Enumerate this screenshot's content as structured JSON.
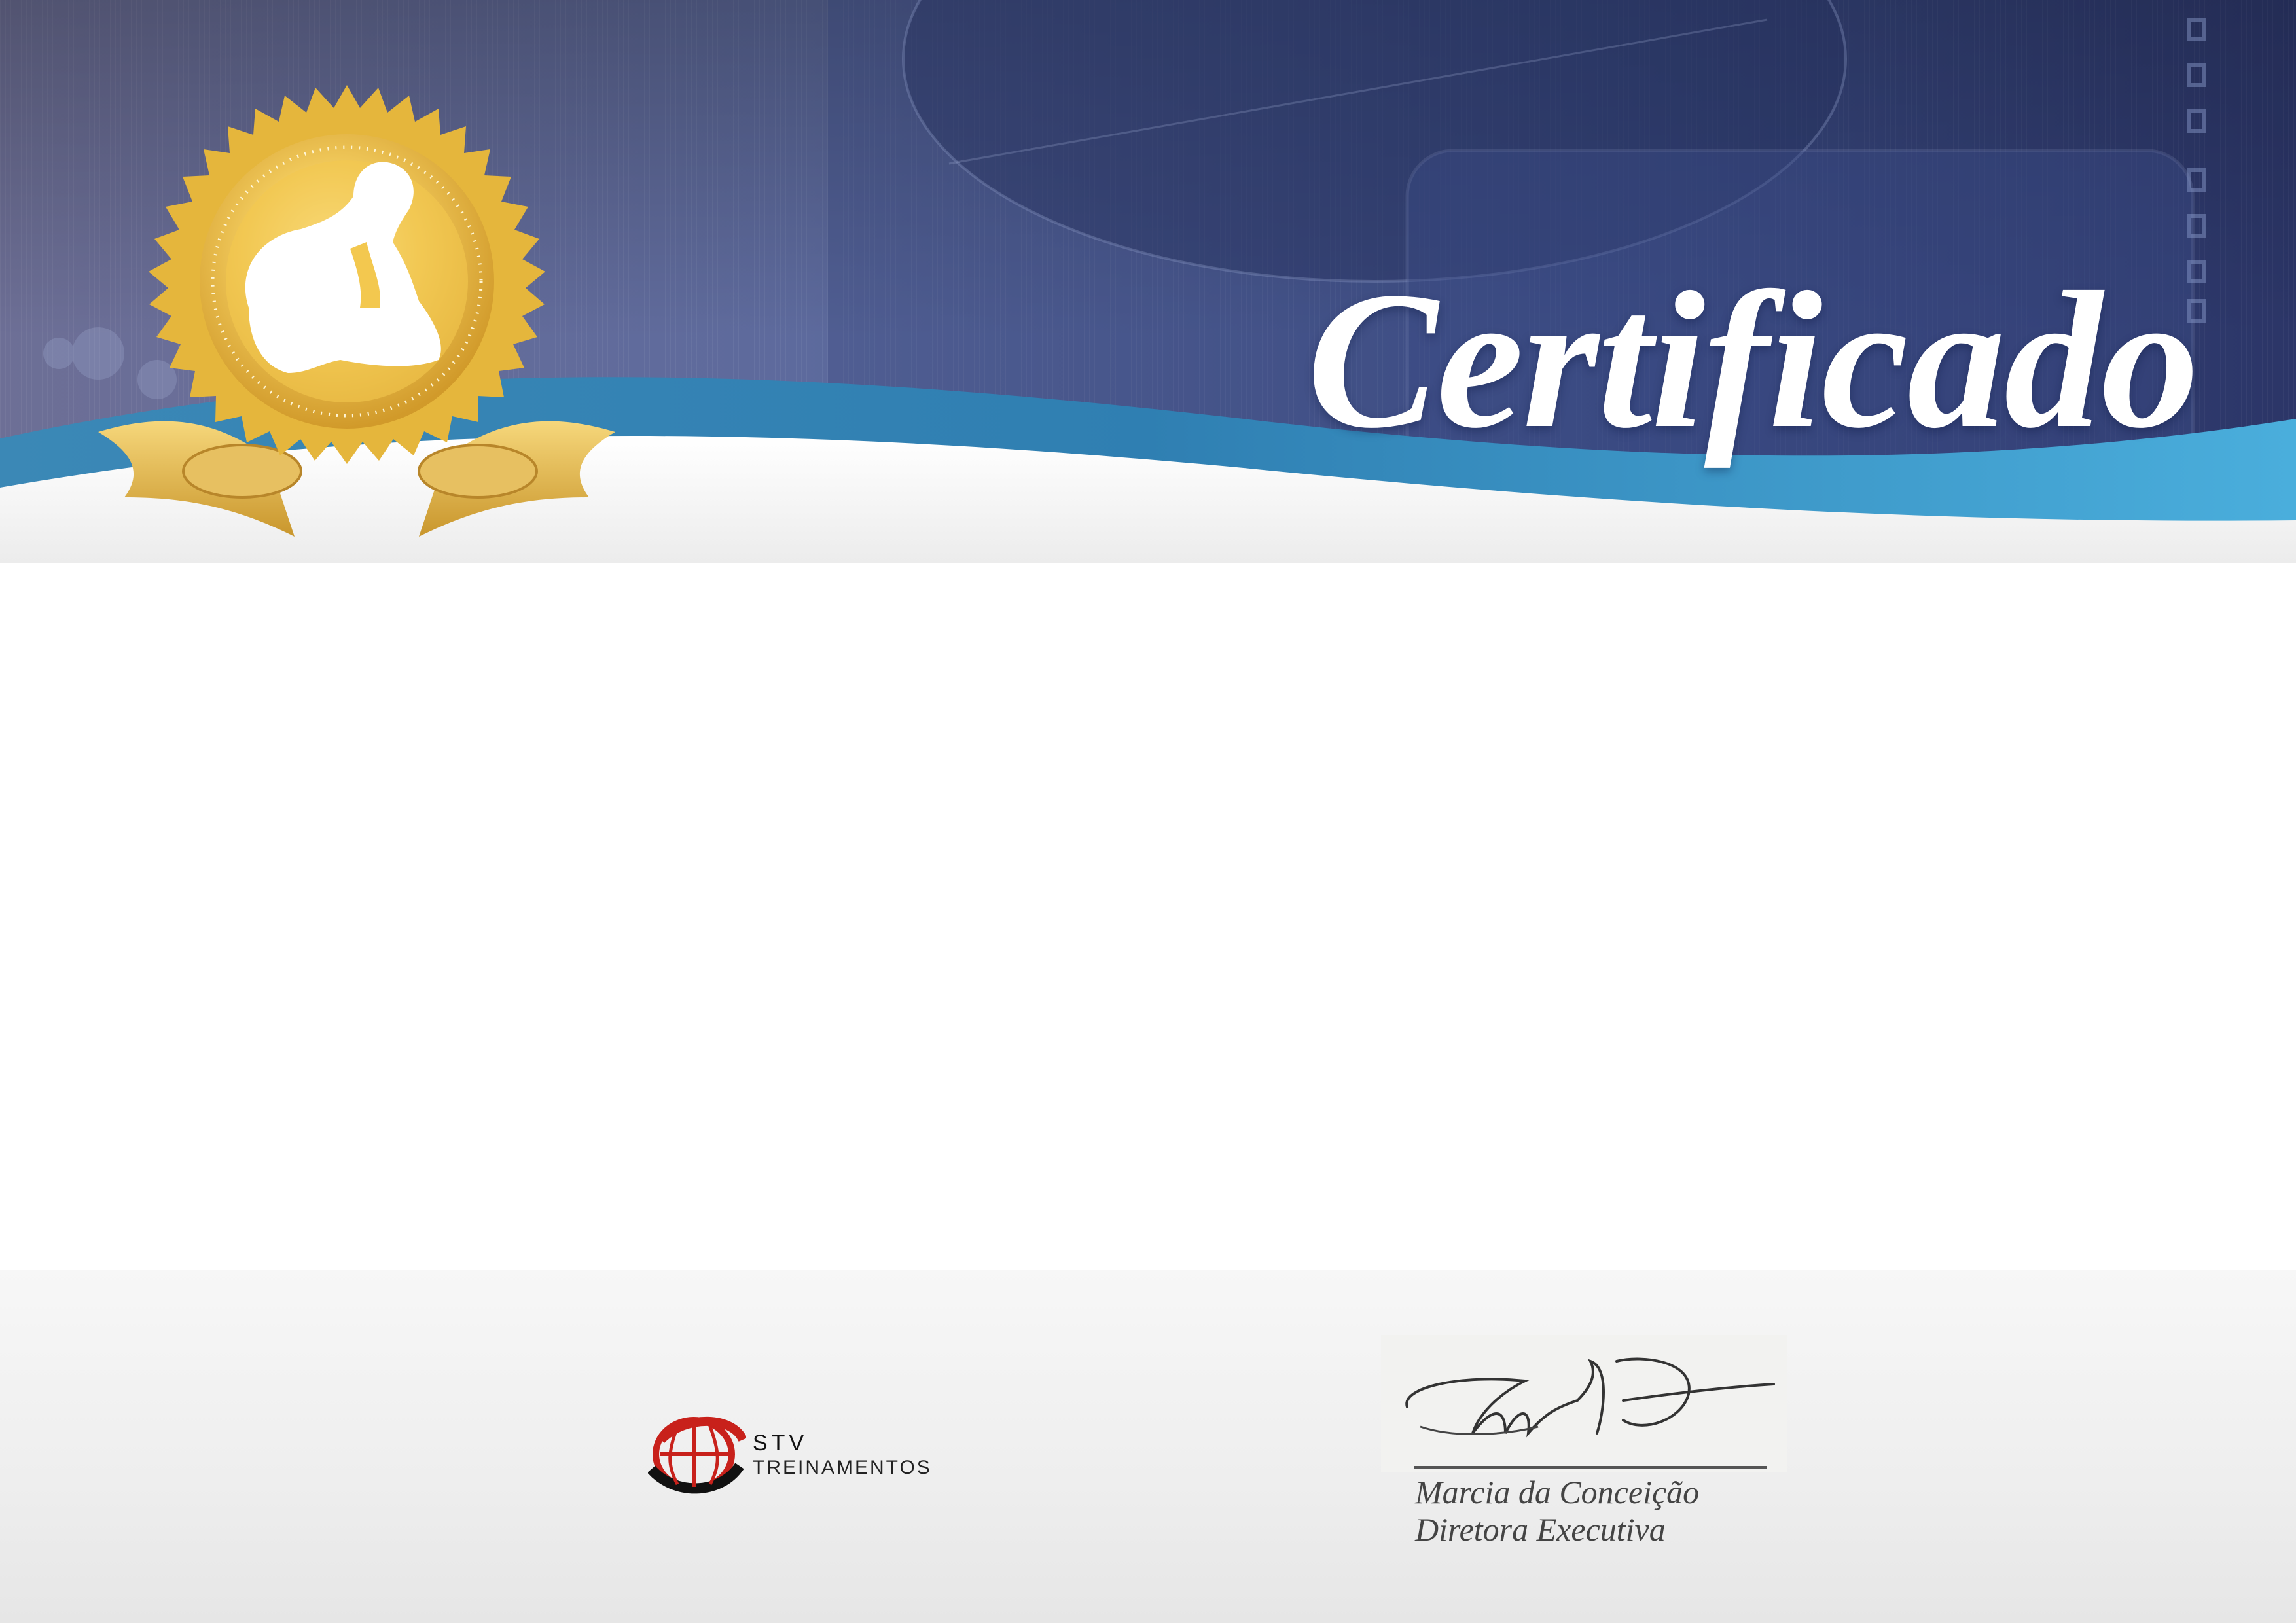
{
  "header": {
    "title": "Certificado",
    "colors": {
      "navy": "#2b3566",
      "mid_blue": "#5a6aa0",
      "teal_wave": "#3f9ccb",
      "gold": "#e8bd4a"
    }
  },
  "seal": {
    "icon": "gold-seal-with-kneeling-figure-icon"
  },
  "footer": {
    "logo": {
      "line1": "STV",
      "line2": "TREINAMENTOS",
      "icon": "globe-logo-icon"
    },
    "signature": {
      "name": "Marcia da Conceição",
      "role": "Diretora Executiva"
    }
  }
}
